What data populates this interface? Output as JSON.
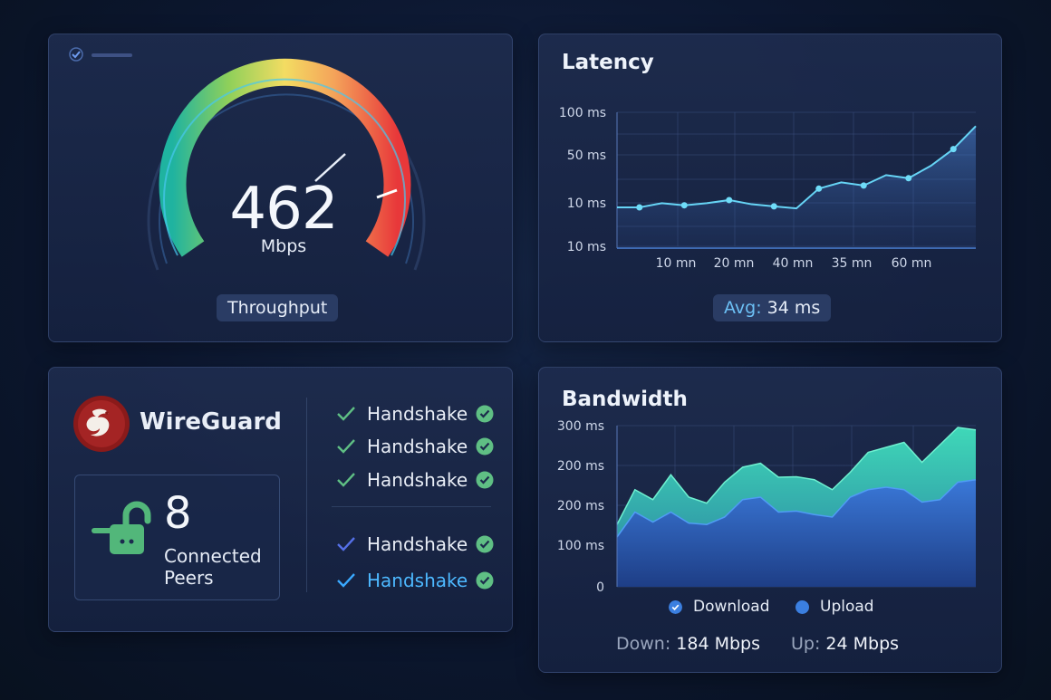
{
  "throughput": {
    "value": "462",
    "unit": "Mbps",
    "label": "Throughput"
  },
  "latency": {
    "title": "Latency",
    "avg_key": "Avg:",
    "avg_value": " 34 ms"
  },
  "wireguard": {
    "name": "WireGuard",
    "peers_count": "8",
    "peers_label": "Connected Peers",
    "handshakes": [
      {
        "label": "Handshake",
        "check_color": "#5fbf84",
        "label_color": "#e8edf6"
      },
      {
        "label": "Handshake",
        "check_color": "#5fbf84",
        "label_color": "#e8edf6"
      },
      {
        "label": "Handshake",
        "check_color": "#5fbf84",
        "label_color": "#e8edf6"
      },
      {
        "label": "Handshake",
        "check_color": "#5570e8",
        "label_color": "#e8edf6"
      },
      {
        "label": "Handshake",
        "check_color": "#3aa9ff",
        "label_color": "#4db8ff"
      }
    ]
  },
  "bandwidth": {
    "title": "Bandwidth",
    "legend_download": "Download",
    "legend_upload": "Upload",
    "down_key": "Down:",
    "down_value": " 184 Mbps",
    "up_key": "Up:",
    "up_value": " 24 Mbps"
  },
  "colors": {
    "accent_cyan": "#5cd6f5",
    "download_teal": "#3fd1b4",
    "upload_blue": "#3b7fe0",
    "check_green": "#5fbf84",
    "wireguard_red": "#8a1a1a"
  },
  "chart_data": [
    {
      "type": "line",
      "title": "Latency",
      "y_tick_labels": [
        "100 ms",
        "50 ms",
        "10 ms",
        "10 ms"
      ],
      "x_tick_labels": [
        "10 mn",
        "20 mn",
        "40 mn",
        "35 mn",
        "60 mn"
      ],
      "series": [
        {
          "values": [
            10,
            10,
            14,
            12,
            14,
            17,
            13,
            11,
            9,
            28,
            34,
            31,
            41,
            38,
            50,
            66,
            88
          ]
        }
      ],
      "grid": true
    },
    {
      "type": "area",
      "title": "Bandwidth",
      "y_tick_labels": [
        "300 ms",
        "200 ms",
        "200 ms",
        "100 ms",
        "0"
      ],
      "series": [
        {
          "name": "Download",
          "values": [
            125,
            195,
            175,
            225,
            180,
            168,
            210,
            240,
            248,
            220,
            221,
            215,
            195,
            230,
            270,
            280,
            290,
            250,
            285,
            320,
            315
          ]
        },
        {
          "name": "Upload",
          "values": [
            100,
            150,
            130,
            150,
            128,
            125,
            140,
            175,
            180,
            150,
            152,
            145,
            140,
            180,
            195,
            200,
            195,
            170,
            175,
            210,
            215
          ]
        }
      ],
      "legend": "bottom",
      "grid": true
    }
  ]
}
